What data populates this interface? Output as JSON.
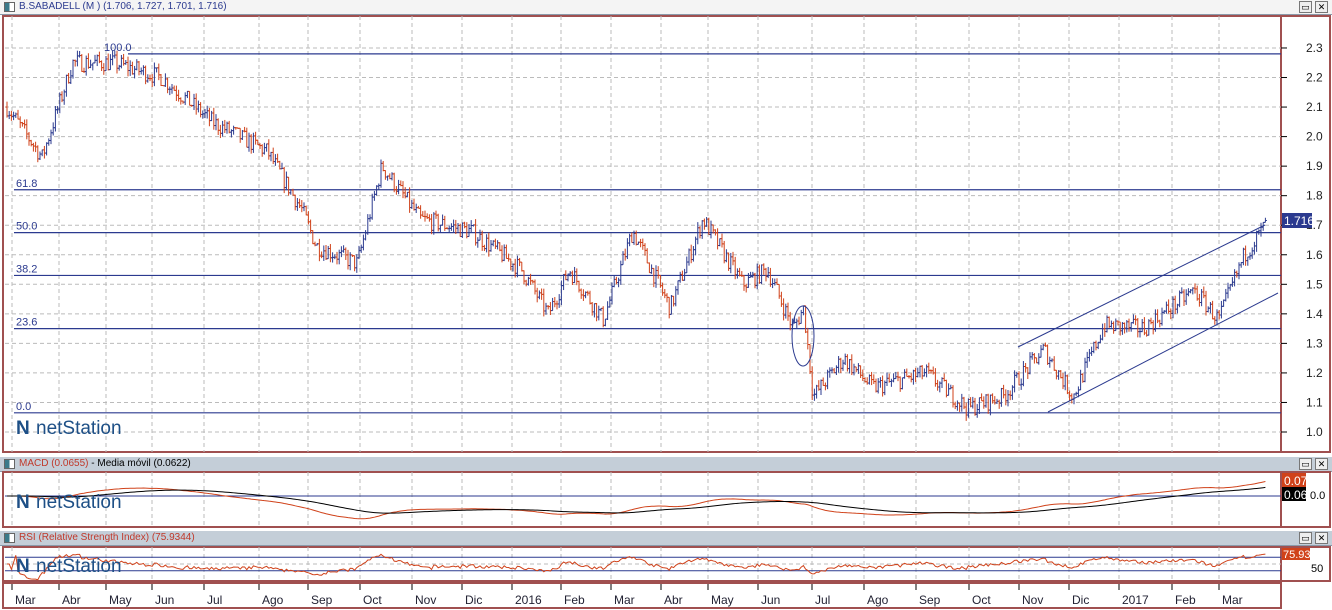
{
  "main": {
    "title": "B.SABADELL (M ) (1.706, 1.727, 1.701, 1.716)",
    "last_price": "1.716"
  },
  "macd": {
    "title_macd": "MACD (0.0655)",
    "title_ma": "Media móvil (0.0622)",
    "last_macd": "0.07",
    "last_ma": "0.06",
    "axis": "0.0"
  },
  "rsi": {
    "title": "RSI (Relative Strength Index) (75.9344)",
    "last": "75.93",
    "axis": "50"
  },
  "watermark": "netStation",
  "buttons": {
    "restore": "▭",
    "close": "✕"
  },
  "colors": {
    "up": "#2b3a8f",
    "down": "#d0421a",
    "grid": "#bbbbbb",
    "fib": "#2b3a8f",
    "frame": "#a05050"
  },
  "chart_data": {
    "type": "ohlc",
    "title": "B.SABADELL (M)",
    "ylim": [
      0.95,
      2.38
    ],
    "yticks": [
      "1.0",
      "1.1",
      "1.2",
      "1.3",
      "1.4",
      "1.5",
      "1.6",
      "1.7",
      "1.8",
      "1.9",
      "2.0",
      "2.1",
      "2.2",
      "2.3"
    ],
    "xticks": [
      "Mar",
      "Abr",
      "May",
      "Jun",
      "Jul",
      "Ago",
      "Sep",
      "Oct",
      "Nov",
      "Dic",
      "2016",
      "Feb",
      "Mar",
      "Abr",
      "May",
      "Jun",
      "Jul",
      "Ago",
      "Sep",
      "Oct",
      "Nov",
      "Dic",
      "2017",
      "Feb",
      "Mar"
    ],
    "fib_levels": [
      {
        "label": "100.0",
        "price": 2.28
      },
      {
        "label": "61.8",
        "price": 1.82
      },
      {
        "label": "50.0",
        "price": 1.675
      },
      {
        "label": "38.2",
        "price": 1.53
      },
      {
        "label": "23.6",
        "price": 1.35
      },
      {
        "label": "0.0",
        "price": 1.065
      }
    ],
    "close_anchors_by_week": [
      [
        0,
        2.1
      ],
      [
        3,
        1.93
      ],
      [
        5.6,
        2.25
      ],
      [
        9.1,
        2.25
      ],
      [
        13.2,
        2.2
      ],
      [
        17.5,
        2.05
      ],
      [
        22.2,
        1.95
      ],
      [
        25.2,
        1.75
      ],
      [
        26.4,
        1.63
      ],
      [
        29.9,
        1.57
      ],
      [
        32,
        1.9
      ],
      [
        35.3,
        1.72
      ],
      [
        39.6,
        1.68
      ],
      [
        43.9,
        1.55
      ],
      [
        46.2,
        1.4
      ],
      [
        48,
        1.55
      ],
      [
        50.9,
        1.38
      ],
      [
        53.4,
        1.68
      ],
      [
        56.6,
        1.42
      ],
      [
        59.4,
        1.72
      ],
      [
        62.8,
        1.5
      ],
      [
        64.9,
        1.55
      ],
      [
        67.1,
        1.35
      ],
      [
        68,
        1.42
      ],
      [
        68.8,
        1.12
      ],
      [
        71.4,
        1.25
      ],
      [
        73.9,
        1.15
      ],
      [
        78.4,
        1.2
      ],
      [
        82,
        1.08
      ],
      [
        85,
        1.12
      ],
      [
        88.5,
        1.28
      ],
      [
        91,
        1.12
      ],
      [
        93.6,
        1.36
      ],
      [
        97,
        1.35
      ],
      [
        101.3,
        1.48
      ],
      [
        103.4,
        1.38
      ],
      [
        105.6,
        1.6
      ],
      [
        107.7,
        1.716
      ]
    ],
    "last": {
      "open": 1.706,
      "high": 1.727,
      "low": 1.701,
      "close": 1.716
    }
  }
}
